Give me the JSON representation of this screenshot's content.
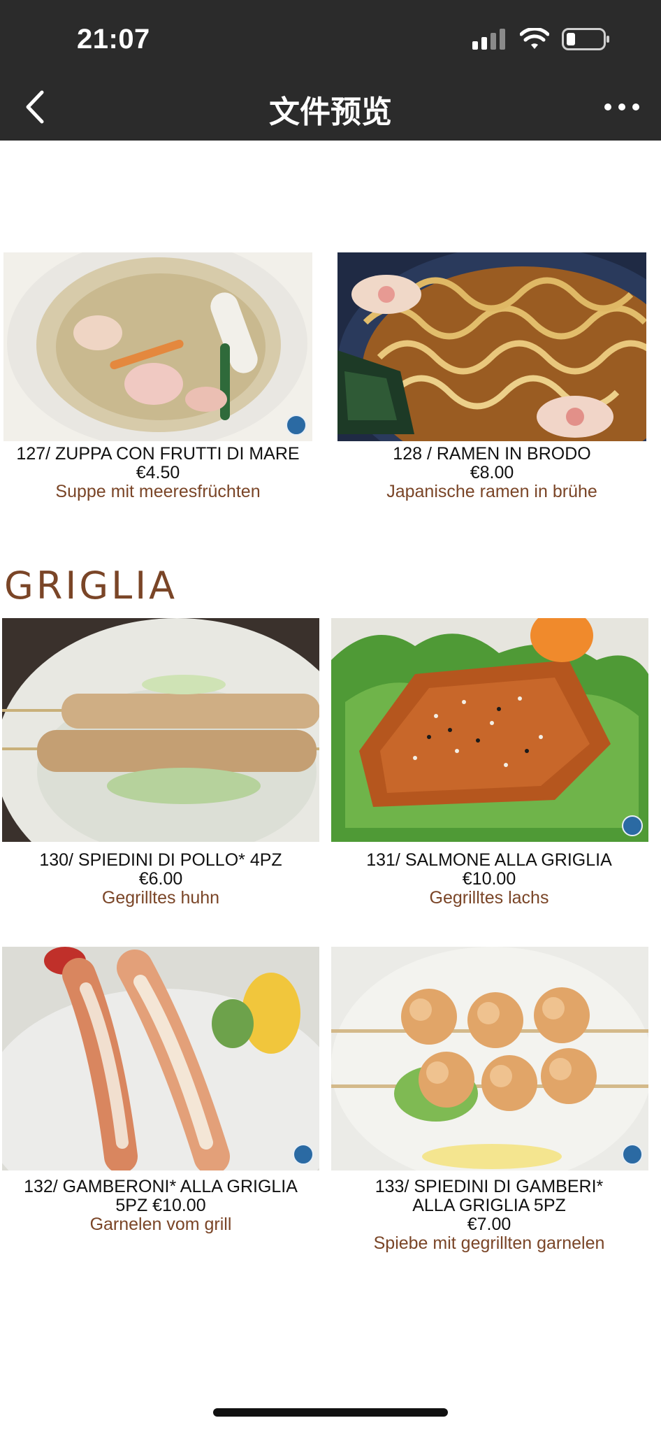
{
  "status_bar": {
    "time": "21:07"
  },
  "nav": {
    "title": "文件预览"
  },
  "items_top": [
    {
      "title": "127/ ZUPPA CON FRUTTI DI MARE",
      "price": "€4.50",
      "german": "Suppe mit meeresfrüchten"
    },
    {
      "title": "128 / RAMEN IN BRODO",
      "price": "€8.00",
      "german": "Japanische ramen in brühe"
    }
  ],
  "section": {
    "title": "GRIGLIA"
  },
  "items_griglia": [
    {
      "title": "130/ SPIEDINI DI POLLO* 4PZ",
      "price": "€6.00",
      "german": "Gegrilltes huhn"
    },
    {
      "title": "131/ SALMONE ALLA GRIGLIA",
      "price": "€10.00",
      "german": "Gegrilltes lachs"
    },
    {
      "title_line1": "132/ GAMBERONI* ALLA GRIGLIA",
      "title_line2": "5PZ  €10.00",
      "german": "Garnelen vom grill"
    },
    {
      "title_line1": "133/ SPIEDINI DI GAMBERI*",
      "title_line2": "ALLA GRIGLIA 5PZ",
      "price": "€7.00",
      "german": "Spiebe mit gegrillten garnelen"
    }
  ],
  "colors": {
    "topbar": "#2b2b2b",
    "accent_brown": "#7a4527"
  },
  "icons": [
    "back-chevron-icon",
    "more-dots-icon",
    "signal-icon",
    "wifi-icon",
    "battery-icon",
    "fish-icon"
  ]
}
